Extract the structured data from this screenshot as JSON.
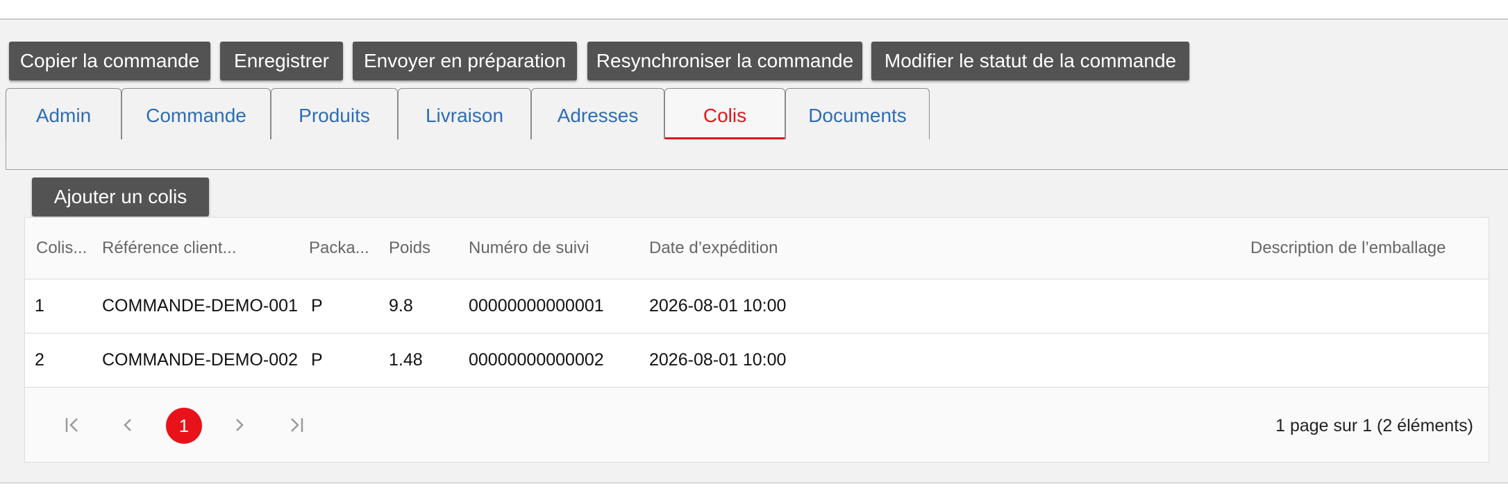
{
  "toolbar": {
    "copy_label": "Copier la commande",
    "save_label": "Enregistrer",
    "send_label": "Envoyer en préparation",
    "resync_label": "Resynchroniser la commande",
    "status_label": "Modifier le statut de la commande"
  },
  "tabs": [
    {
      "label": "Admin"
    },
    {
      "label": "Commande"
    },
    {
      "label": "Produits"
    },
    {
      "label": "Livraison"
    },
    {
      "label": "Adresses"
    },
    {
      "label": "Colis",
      "active": true
    },
    {
      "label": "Documents"
    }
  ],
  "add_parcel_label": "Ajouter un colis",
  "table": {
    "headers": [
      "Colis...",
      "Référence client...",
      "Packa...",
      "Poids",
      "Numéro de suivi",
      "Date d’expédition",
      "Description de l’emballage"
    ],
    "rows": [
      [
        "1",
        "COMMANDE-DEMO-001",
        "P",
        "9.8",
        "00000000000001",
        "2026-08-01 10:00",
        ""
      ],
      [
        "2",
        "COMMANDE-DEMO-002",
        "P",
        "1.48",
        "00000000000002",
        "2026-08-01 10:00",
        ""
      ]
    ]
  },
  "pager": {
    "first_icon": "first-page-icon",
    "prev_icon": "prev-page-icon",
    "current_page": "1",
    "next_icon": "next-page-icon",
    "last_icon": "last-page-icon",
    "info": "1 page sur 1 (2 éléments)"
  },
  "colors": {
    "button_bg": "#535353",
    "tab_text": "#2e6db4",
    "active_accent": "#e0161b"
  }
}
